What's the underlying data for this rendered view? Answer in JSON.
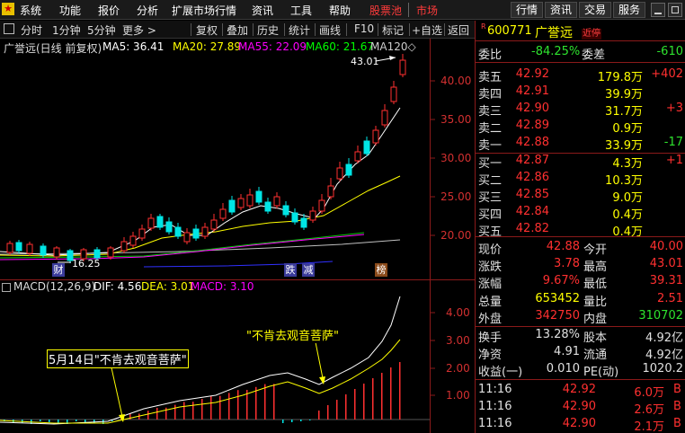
{
  "menu": {
    "items": [
      "系统",
      "功能",
      "报价",
      "分析",
      "扩展市场行情",
      "资讯",
      "工具",
      "帮助",
      "股票池",
      "市场"
    ],
    "right_buttons": [
      "行情",
      "资讯",
      "交易",
      "服务"
    ]
  },
  "toolbar": {
    "items": [
      "分时",
      "1分钟",
      "5分钟",
      "更多 >",
      "复权",
      "叠加",
      "历史",
      "统计",
      "画线",
      "F10",
      "标记",
      "+自选",
      "返回"
    ]
  },
  "chart": {
    "legend_name": "广誉远(日线 前复权)",
    "ma_labels": [
      {
        "text": "MA5: 36.41",
        "color": "#ffffff"
      },
      {
        "text": "MA20: 27.89",
        "color": "#ffff00"
      },
      {
        "text": "MA55: 22.09",
        "color": "#ff00ff"
      },
      {
        "text": "MA60: 21.67",
        "color": "#00ff00"
      },
      {
        "text": "MA120◇",
        "color": "#cccccc"
      }
    ],
    "price_ticks": [
      "40.00",
      "35.00",
      "30.00",
      "25.00",
      "20.00"
    ],
    "high_label": "43.01",
    "low_label": "16.25",
    "event_labels": [
      "财",
      "跌",
      "减",
      "榜"
    ],
    "macd_title": "MACD(12,26,9)",
    "macd_values": [
      {
        "text": "DIF: 4.56",
        "color": "#ffffff"
      },
      {
        "text": "DEA: 3.01",
        "color": "#ffff00"
      },
      {
        "text": "MACD: 3.10",
        "color": "#ff00ff"
      }
    ],
    "macd_ticks": [
      "4.00",
      "3.00",
      "2.00",
      "1.00"
    ],
    "annotation_1": "\"不肯去观音菩萨\"",
    "annotation_2": "5月14日\"不肯去观音菩萨\""
  },
  "quote": {
    "code": "600771",
    "name": "广誉远",
    "badge": "近停",
    "ratio_label": "委比",
    "ratio_value": "-84.25%",
    "diff_label": "委差",
    "diff_value": "-610",
    "asks": [
      {
        "label": "卖五",
        "price": "42.92",
        "vol": "179.8万",
        "chg": "+402"
      },
      {
        "label": "卖四",
        "price": "42.91",
        "vol": "39.9万",
        "chg": ""
      },
      {
        "label": "卖三",
        "price": "42.90",
        "vol": "31.7万",
        "chg": "+3"
      },
      {
        "label": "卖二",
        "price": "42.89",
        "vol": "0.9万",
        "chg": ""
      },
      {
        "label": "卖一",
        "price": "42.88",
        "vol": "33.9万",
        "chg": "-17"
      }
    ],
    "bids": [
      {
        "label": "买一",
        "price": "42.87",
        "vol": "4.3万",
        "chg": "+1"
      },
      {
        "label": "买二",
        "price": "42.86",
        "vol": "10.3万",
        "chg": ""
      },
      {
        "label": "买三",
        "price": "42.85",
        "vol": "9.0万",
        "chg": ""
      },
      {
        "label": "买四",
        "price": "42.84",
        "vol": "0.4万",
        "chg": ""
      },
      {
        "label": "买五",
        "price": "42.82",
        "vol": "0.4万",
        "chg": ""
      }
    ],
    "stats": [
      {
        "l1": "现价",
        "v1": "42.88",
        "c1": "red",
        "l2": "今开",
        "v2": "40.00",
        "c2": "red"
      },
      {
        "l1": "涨跌",
        "v1": "3.78",
        "c1": "red",
        "l2": "最高",
        "v2": "43.01",
        "c2": "red"
      },
      {
        "l1": "涨幅",
        "v1": "9.67%",
        "c1": "red",
        "l2": "最低",
        "v2": "39.31",
        "c2": "red"
      },
      {
        "l1": "总量",
        "v1": "653452",
        "c1": "yel",
        "l2": "量比",
        "v2": "2.51",
        "c2": "red"
      },
      {
        "l1": "外盘",
        "v1": "342750",
        "c1": "red",
        "l2": "内盘",
        "v2": "310702",
        "c2": "grn"
      }
    ],
    "stats2": [
      {
        "l1": "换手",
        "v1": "13.28%",
        "c1": "w",
        "l2": "股本",
        "v2": "4.92亿",
        "c2": "w"
      },
      {
        "l1": "净资",
        "v1": "4.91",
        "c1": "w",
        "l2": "流通",
        "v2": "4.92亿",
        "c2": "w"
      },
      {
        "l1": "收益(一)",
        "v1": "0.010",
        "c1": "w",
        "l2": "PE(动)",
        "v2": "1020.2",
        "c2": "w"
      }
    ],
    "ticks": [
      {
        "time": "11:16",
        "price": "42.92",
        "vol": "6.0万",
        "dir": "B"
      },
      {
        "time": "11:16",
        "price": "42.90",
        "vol": "2.6万",
        "dir": "B"
      },
      {
        "time": "11:16",
        "price": "42.90",
        "vol": "2.1万",
        "dir": "B"
      }
    ]
  }
}
